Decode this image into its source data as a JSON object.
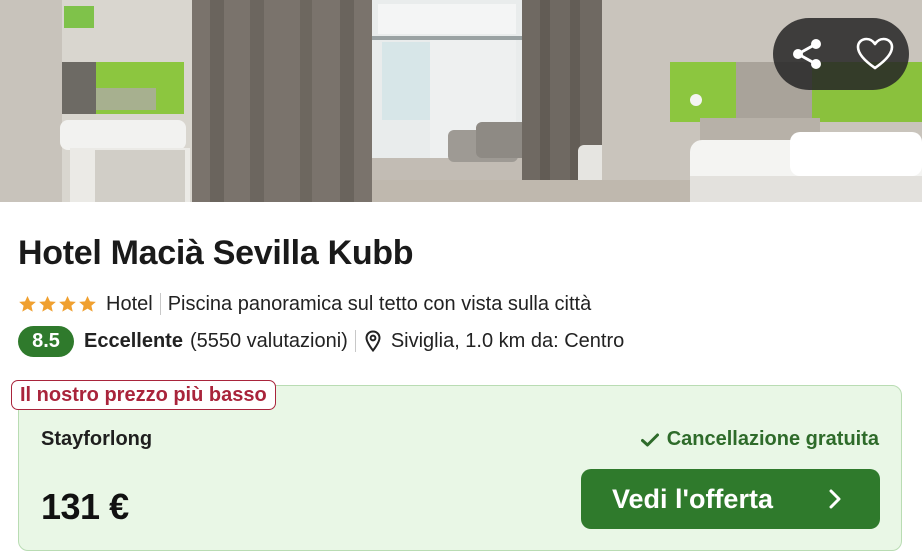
{
  "hotel": {
    "name": "Hotel Macià Sevilla Kubb",
    "stars": 4,
    "type": "Hotel",
    "highlight": "Piscina panoramica sul tetto con vista sulla città"
  },
  "rating": {
    "score": "8.5",
    "label": "Eccellente",
    "count_text": "(5550 valutazioni)"
  },
  "location": {
    "text": "Siviglia, 1.0 km da: Centro"
  },
  "offer": {
    "badge": "Il nostro prezzo più basso",
    "provider": "Stayforlong",
    "cancellation": "Cancellazione gratuita",
    "price": "131 €",
    "cta_label": "Vedi l'offerta"
  },
  "icons": {
    "share": "share-icon",
    "favorite": "heart-icon",
    "location": "map-pin-icon",
    "check": "check-icon",
    "chevron": "chevron-right-icon",
    "star": "star-icon"
  },
  "colors": {
    "accent_green": "#2f7a2c",
    "offer_background": "#e9f7e6",
    "badge_red": "#a9243b",
    "star_orange": "#f0a030"
  }
}
